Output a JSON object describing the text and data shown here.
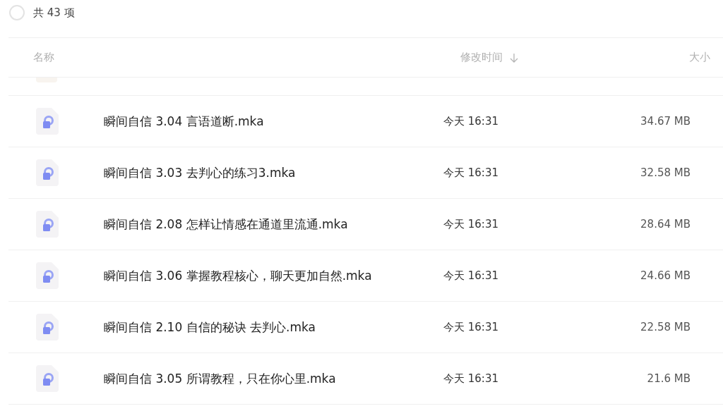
{
  "summary": {
    "checked": false,
    "count_text": "共 43 项"
  },
  "columns": [
    {
      "label": "名称",
      "kind": "name"
    },
    {
      "label": "修改时间",
      "kind": "time",
      "sorted": true
    },
    {
      "label": "大小",
      "kind": "size"
    }
  ],
  "rows": [
    {
      "name": "瞬间自信 3.04 言语道断.mka",
      "modified": "今天 16:31",
      "size": "34.67 MB"
    },
    {
      "name": "瞬间自信 3.03 去判心的练习3.mka",
      "modified": "今天 16:31",
      "size": "32.58 MB"
    },
    {
      "name": "瞬间自信 2.08 怎样让情感在通道里流通.mka",
      "modified": "今天 16:31",
      "size": "28.64 MB"
    },
    {
      "name": "瞬间自信 3.06 掌握教程核心，聊天更加自然.mka",
      "modified": "今天 16:31",
      "size": "24.66 MB"
    },
    {
      "name": "瞬间自信 2.10 自信的秘诀 去判心.mka",
      "modified": "今天 16:31",
      "size": "22.58 MB"
    },
    {
      "name": "瞬间自信 3.05 所谓教程，只在你心里.mka",
      "modified": "今天 16:31",
      "size": "21.6 MB"
    }
  ]
}
